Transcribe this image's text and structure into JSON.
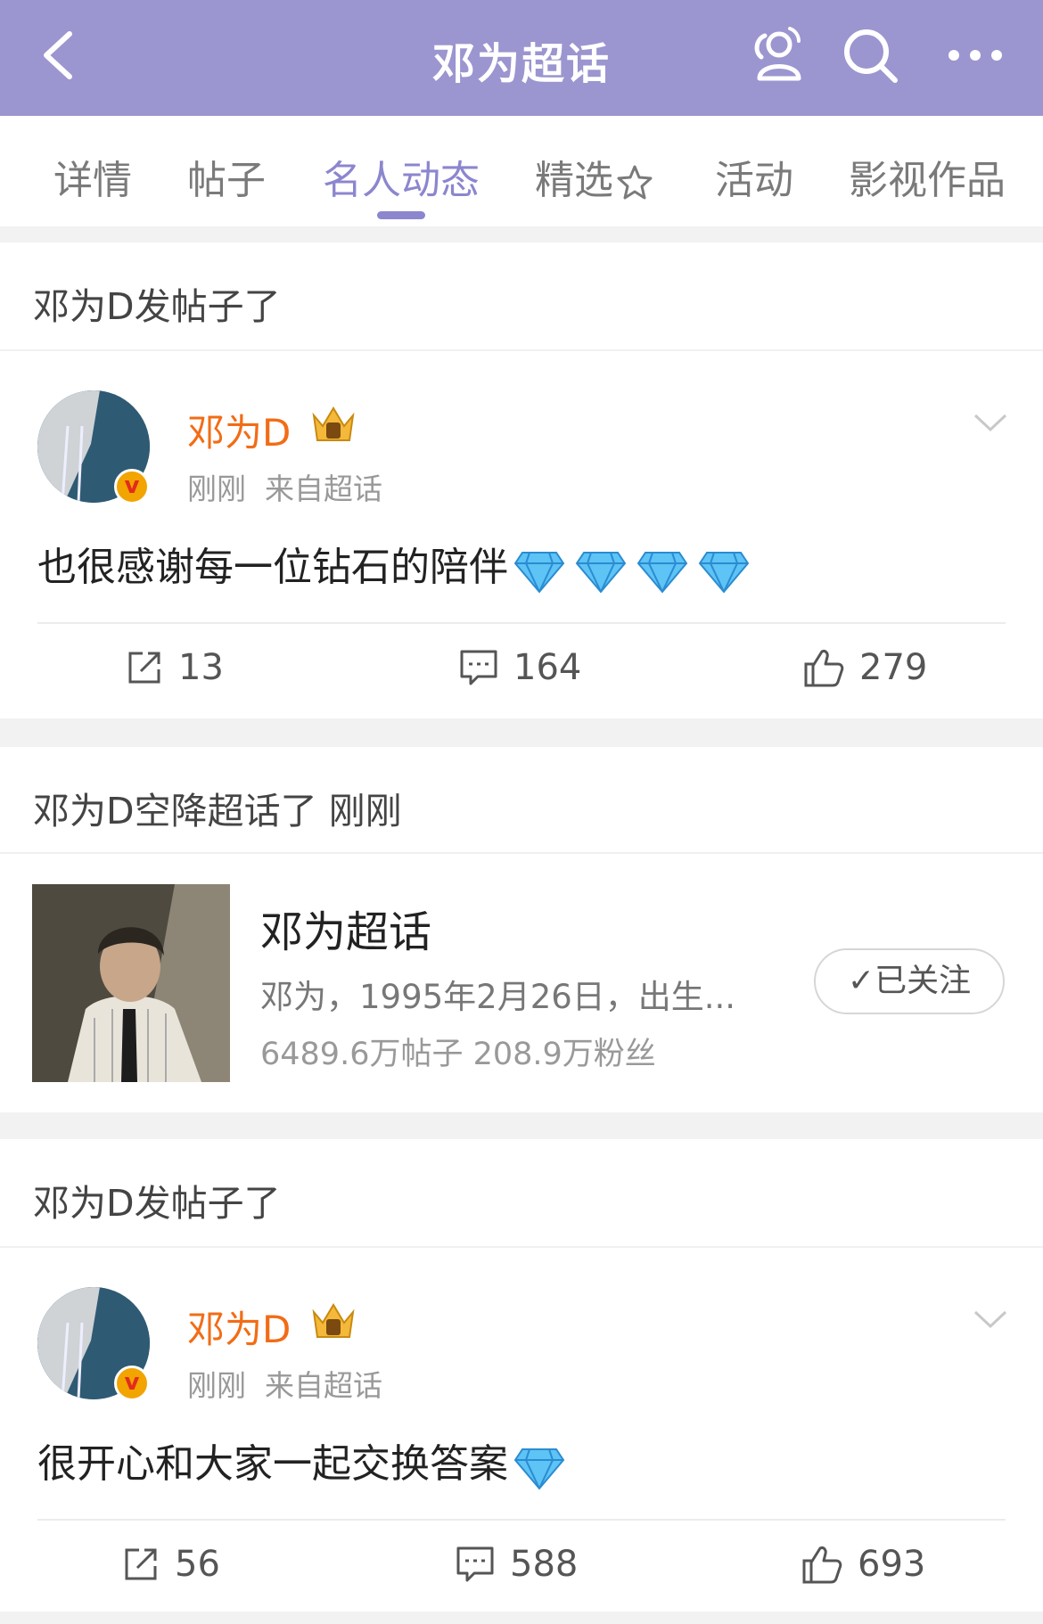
{
  "header": {
    "title": "邓为超话",
    "background": "#9b95d0",
    "icons": [
      "back-icon",
      "community-icon",
      "search-icon",
      "more-icon"
    ]
  },
  "tabs": [
    {
      "label": "详情",
      "active": false
    },
    {
      "label": "帖子",
      "active": false
    },
    {
      "label": "名人动态",
      "active": true
    },
    {
      "label": "精选",
      "active": false
    },
    {
      "label": "活动",
      "active": false
    },
    {
      "label": "影视作品",
      "active": false
    }
  ],
  "accent_color": "#8c86cf",
  "feed": {
    "post1": {
      "header": "邓为D发帖子了",
      "username": "邓为D",
      "time": "刚刚",
      "source": "来自超话",
      "text": "也很感谢每一位钻石的陪伴",
      "diamond_count": 4,
      "reposts": "13",
      "comments": "164",
      "likes": "279"
    },
    "landing": {
      "header": "邓为D空降超话了 刚刚",
      "topic_name": "邓为超话",
      "topic_desc": "邓为，1995年2月26日，出生...",
      "topic_stats": "6489.6万帖子  208.9万粉丝",
      "follow_label": "已关注"
    },
    "post2": {
      "header": "邓为D发帖子了",
      "username": "邓为D",
      "time": "刚刚",
      "source": "来自超话",
      "text": "很开心和大家一起交换答案",
      "diamond_count": 1,
      "reposts": "56",
      "comments": "588",
      "likes": "693"
    }
  }
}
